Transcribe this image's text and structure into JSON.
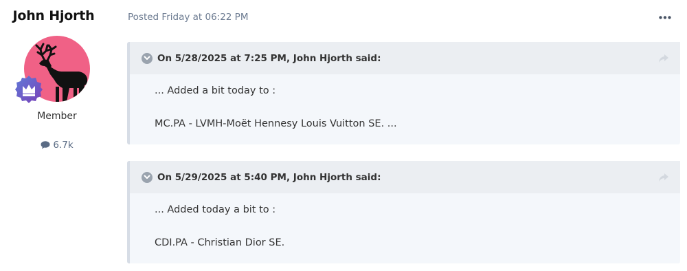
{
  "author": {
    "name": "John Hjorth",
    "title": "Member",
    "post_count": "6.7k",
    "avatar_icon": "deer-silhouette-icon",
    "badge_icon": "crown-rank-badge-icon",
    "post_count_icon": "speech-bubble-icon"
  },
  "post": {
    "meta": "Posted Friday at 06:22 PM",
    "menu_icon": "ellipsis-icon"
  },
  "quotes": [
    {
      "cite": "On 5/28/2025 at 7:25 PM, John Hjorth said:",
      "line1": "... Added a bit today to :",
      "line2": "MC.PA - LVMH-Moët Hennesy Louis Vuitton SE. ..."
    },
    {
      "cite": "On 5/29/2025 at 5:40 PM, John Hjorth said:",
      "line1": "... Added today a bit to :",
      "line2": "CDI.PA - Christian Dior SE."
    }
  ],
  "colors": {
    "avatar_bg": "#f06186",
    "quote_bg": "#f4f7fb",
    "quote_header_bg": "#ebeef2",
    "meta_text": "#6b7a90"
  }
}
